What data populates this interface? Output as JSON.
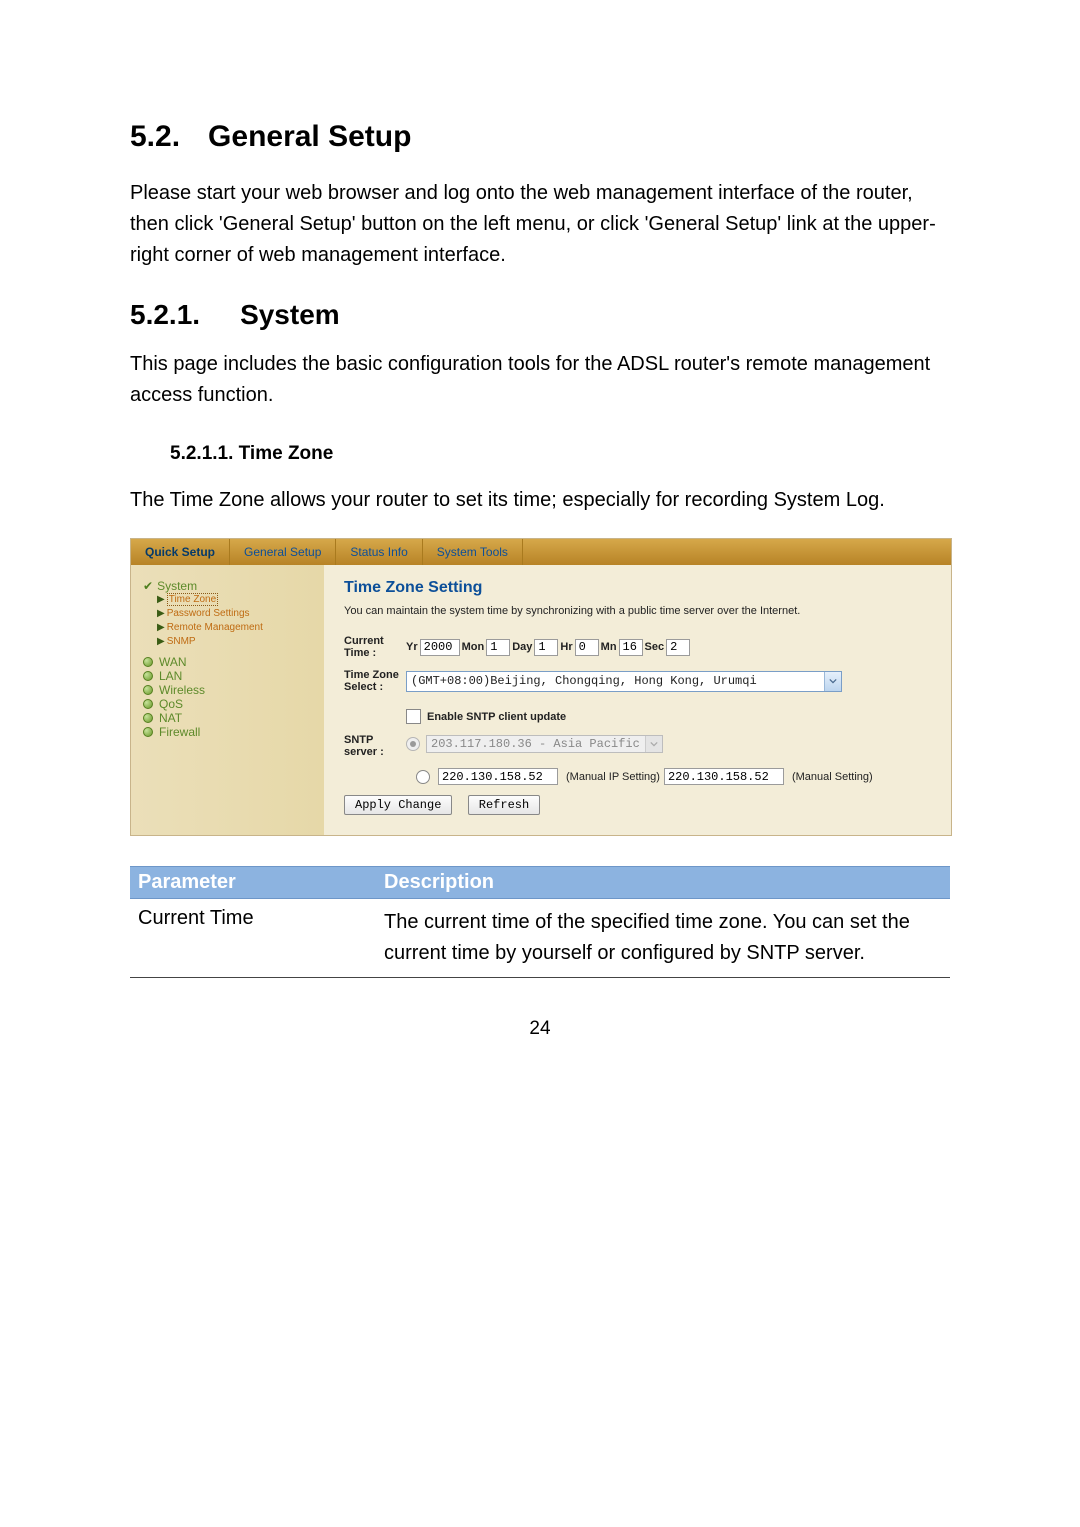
{
  "doc": {
    "h1_num": "5.2.",
    "h1_title": "General Setup",
    "p1": "Please start your web browser and log onto the web management interface of the router, then click 'General Setup' button on the left menu, or click 'General Setup' link at the upper-right corner of web management interface.",
    "h2_num": "5.2.1.",
    "h2_title": "System",
    "p2": "This page includes the basic configuration tools for the ADSL router's remote management access function.",
    "h3": "5.2.1.1. Time Zone",
    "p3": "The Time Zone allows your router to set its time; especially for recording System Log.",
    "page_number": "24"
  },
  "router": {
    "tabs": {
      "quick_setup": "Quick Setup",
      "general_setup": "General Setup",
      "status_info": "Status Info",
      "system_tools": "System Tools"
    },
    "sidebar": {
      "system": "System",
      "time_zone": "Time Zone",
      "password_settings": "Password Settings",
      "remote_management": "Remote Management",
      "snmp": "SNMP",
      "wan": "WAN",
      "lan": "LAN",
      "wireless": "Wireless",
      "qos": "QoS",
      "nat": "NAT",
      "firewall": "Firewall"
    },
    "content": {
      "title": "Time Zone Setting",
      "desc": "You can maintain the system time by synchronizing with a public time server over the Internet.",
      "labels": {
        "current_time": "Current Time :",
        "yr": "Yr",
        "mon": "Mon",
        "day": "Day",
        "hr": "Hr",
        "mn": "Mn",
        "sec": "Sec",
        "time_zone_select": "Time Zone Select :",
        "enable_sntp": "Enable SNTP client update",
        "sntp_server": "SNTP server :",
        "manual_ip_setting": "(Manual IP Setting)",
        "manual_setting": "(Manual Setting)"
      },
      "values": {
        "yr": "2000",
        "mon": "1",
        "day": "1",
        "hr": "0",
        "mn": "16",
        "sec": "2",
        "tz": "(GMT+08:00)Beijing, Chongqing, Hong Kong, Urumqi",
        "sntp_preset": "203.117.180.36 - Asia Pacific",
        "manual_ip1": "220.130.158.52",
        "manual_ip2": "220.130.158.52"
      },
      "buttons": {
        "apply": "Apply Change",
        "refresh": "Refresh"
      }
    }
  },
  "param_table": {
    "head_param": "Parameter",
    "head_desc": "Description",
    "rows": [
      {
        "param": "Current Time",
        "desc": "The current time of the specified time zone. You can set the current time by yourself or configured by SNTP server."
      }
    ]
  }
}
